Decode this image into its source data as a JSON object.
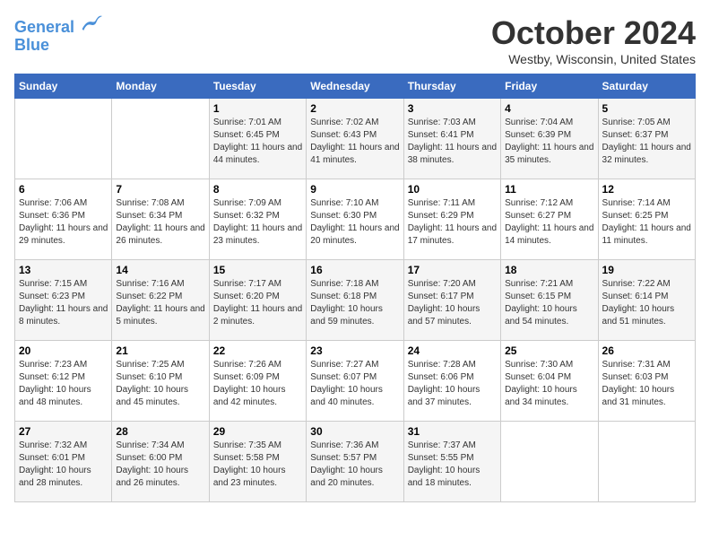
{
  "header": {
    "logo_line1": "General",
    "logo_line2": "Blue",
    "month": "October 2024",
    "location": "Westby, Wisconsin, United States"
  },
  "days_of_week": [
    "Sunday",
    "Monday",
    "Tuesday",
    "Wednesday",
    "Thursday",
    "Friday",
    "Saturday"
  ],
  "weeks": [
    [
      {
        "day": "",
        "info": ""
      },
      {
        "day": "",
        "info": ""
      },
      {
        "day": "1",
        "info": "Sunrise: 7:01 AM\nSunset: 6:45 PM\nDaylight: 11 hours and 44 minutes."
      },
      {
        "day": "2",
        "info": "Sunrise: 7:02 AM\nSunset: 6:43 PM\nDaylight: 11 hours and 41 minutes."
      },
      {
        "day": "3",
        "info": "Sunrise: 7:03 AM\nSunset: 6:41 PM\nDaylight: 11 hours and 38 minutes."
      },
      {
        "day": "4",
        "info": "Sunrise: 7:04 AM\nSunset: 6:39 PM\nDaylight: 11 hours and 35 minutes."
      },
      {
        "day": "5",
        "info": "Sunrise: 7:05 AM\nSunset: 6:37 PM\nDaylight: 11 hours and 32 minutes."
      }
    ],
    [
      {
        "day": "6",
        "info": "Sunrise: 7:06 AM\nSunset: 6:36 PM\nDaylight: 11 hours and 29 minutes."
      },
      {
        "day": "7",
        "info": "Sunrise: 7:08 AM\nSunset: 6:34 PM\nDaylight: 11 hours and 26 minutes."
      },
      {
        "day": "8",
        "info": "Sunrise: 7:09 AM\nSunset: 6:32 PM\nDaylight: 11 hours and 23 minutes."
      },
      {
        "day": "9",
        "info": "Sunrise: 7:10 AM\nSunset: 6:30 PM\nDaylight: 11 hours and 20 minutes."
      },
      {
        "day": "10",
        "info": "Sunrise: 7:11 AM\nSunset: 6:29 PM\nDaylight: 11 hours and 17 minutes."
      },
      {
        "day": "11",
        "info": "Sunrise: 7:12 AM\nSunset: 6:27 PM\nDaylight: 11 hours and 14 minutes."
      },
      {
        "day": "12",
        "info": "Sunrise: 7:14 AM\nSunset: 6:25 PM\nDaylight: 11 hours and 11 minutes."
      }
    ],
    [
      {
        "day": "13",
        "info": "Sunrise: 7:15 AM\nSunset: 6:23 PM\nDaylight: 11 hours and 8 minutes."
      },
      {
        "day": "14",
        "info": "Sunrise: 7:16 AM\nSunset: 6:22 PM\nDaylight: 11 hours and 5 minutes."
      },
      {
        "day": "15",
        "info": "Sunrise: 7:17 AM\nSunset: 6:20 PM\nDaylight: 11 hours and 2 minutes."
      },
      {
        "day": "16",
        "info": "Sunrise: 7:18 AM\nSunset: 6:18 PM\nDaylight: 10 hours and 59 minutes."
      },
      {
        "day": "17",
        "info": "Sunrise: 7:20 AM\nSunset: 6:17 PM\nDaylight: 10 hours and 57 minutes."
      },
      {
        "day": "18",
        "info": "Sunrise: 7:21 AM\nSunset: 6:15 PM\nDaylight: 10 hours and 54 minutes."
      },
      {
        "day": "19",
        "info": "Sunrise: 7:22 AM\nSunset: 6:14 PM\nDaylight: 10 hours and 51 minutes."
      }
    ],
    [
      {
        "day": "20",
        "info": "Sunrise: 7:23 AM\nSunset: 6:12 PM\nDaylight: 10 hours and 48 minutes."
      },
      {
        "day": "21",
        "info": "Sunrise: 7:25 AM\nSunset: 6:10 PM\nDaylight: 10 hours and 45 minutes."
      },
      {
        "day": "22",
        "info": "Sunrise: 7:26 AM\nSunset: 6:09 PM\nDaylight: 10 hours and 42 minutes."
      },
      {
        "day": "23",
        "info": "Sunrise: 7:27 AM\nSunset: 6:07 PM\nDaylight: 10 hours and 40 minutes."
      },
      {
        "day": "24",
        "info": "Sunrise: 7:28 AM\nSunset: 6:06 PM\nDaylight: 10 hours and 37 minutes."
      },
      {
        "day": "25",
        "info": "Sunrise: 7:30 AM\nSunset: 6:04 PM\nDaylight: 10 hours and 34 minutes."
      },
      {
        "day": "26",
        "info": "Sunrise: 7:31 AM\nSunset: 6:03 PM\nDaylight: 10 hours and 31 minutes."
      }
    ],
    [
      {
        "day": "27",
        "info": "Sunrise: 7:32 AM\nSunset: 6:01 PM\nDaylight: 10 hours and 28 minutes."
      },
      {
        "day": "28",
        "info": "Sunrise: 7:34 AM\nSunset: 6:00 PM\nDaylight: 10 hours and 26 minutes."
      },
      {
        "day": "29",
        "info": "Sunrise: 7:35 AM\nSunset: 5:58 PM\nDaylight: 10 hours and 23 minutes."
      },
      {
        "day": "30",
        "info": "Sunrise: 7:36 AM\nSunset: 5:57 PM\nDaylight: 10 hours and 20 minutes."
      },
      {
        "day": "31",
        "info": "Sunrise: 7:37 AM\nSunset: 5:55 PM\nDaylight: 10 hours and 18 minutes."
      },
      {
        "day": "",
        "info": ""
      },
      {
        "day": "",
        "info": ""
      }
    ]
  ]
}
